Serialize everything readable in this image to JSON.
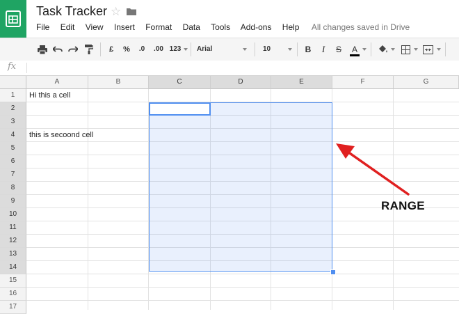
{
  "app": {
    "title": "Task Tracker",
    "menu": [
      "File",
      "Edit",
      "View",
      "Insert",
      "Format",
      "Data",
      "Tools",
      "Add-ons",
      "Help"
    ],
    "save_status": "All changes saved in Drive"
  },
  "toolbar": {
    "currency": "£",
    "percent": "%",
    "decrease_decimals": ".0",
    "increase_decimals": ".00",
    "more_formats": "123",
    "font": "Arial",
    "font_size": "10",
    "bold": "B",
    "italic": "I",
    "strike": "S",
    "text_color": "A",
    "text_color_hex": "#000000"
  },
  "formula_bar": {
    "label": "fx",
    "value": ""
  },
  "columns": [
    "A",
    "B",
    "C",
    "D",
    "E",
    "F",
    "G"
  ],
  "rows": [
    "1",
    "2",
    "3",
    "4",
    "5",
    "6",
    "7",
    "8",
    "9",
    "10",
    "11",
    "12",
    "13",
    "14",
    "15",
    "16",
    "17"
  ],
  "cells": {
    "A1": "Hi this a cell",
    "A4": "this is secoond cell"
  },
  "selection": {
    "range": "C2:E14",
    "active_cell": "C2",
    "color": "#4f8ef0"
  },
  "annotation": {
    "label": "RANGE",
    "color": "#e02020"
  },
  "colors": {
    "brand": "#1fa463"
  }
}
